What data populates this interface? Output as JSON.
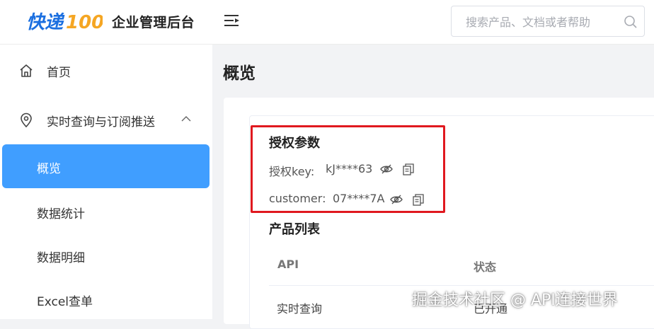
{
  "header": {
    "logo_text": "快递100",
    "subtitle": "企业管理后台",
    "search_placeholder": "搜索产品、文档或者帮助"
  },
  "sidebar": {
    "items": [
      {
        "label": "首页",
        "icon": "home-icon"
      },
      {
        "label": "实时查询与订阅推送",
        "icon": "location-pin-icon",
        "expanded": true
      }
    ],
    "subitems": [
      {
        "label": "概览",
        "active": true
      },
      {
        "label": "数据统计"
      },
      {
        "label": "数据明细"
      },
      {
        "label": "Excel查单"
      }
    ]
  },
  "main": {
    "title": "概览",
    "auth": {
      "title": "授权参数",
      "key_label": "授权key:",
      "key_value": "kJ****63",
      "customer_label": "customer:",
      "customer_value": "07****7A"
    },
    "products": {
      "title": "产品列表",
      "columns": [
        "API",
        "状态"
      ],
      "rows": [
        {
          "api": "实时查询",
          "status": "已开通"
        }
      ]
    }
  },
  "watermark": "掘金技术社区 @ API连接世界",
  "colors": {
    "accent": "#409eff",
    "logo_blue": "#1b6fe0",
    "logo_orange": "#f5a623",
    "highlight": "#e0191f"
  }
}
